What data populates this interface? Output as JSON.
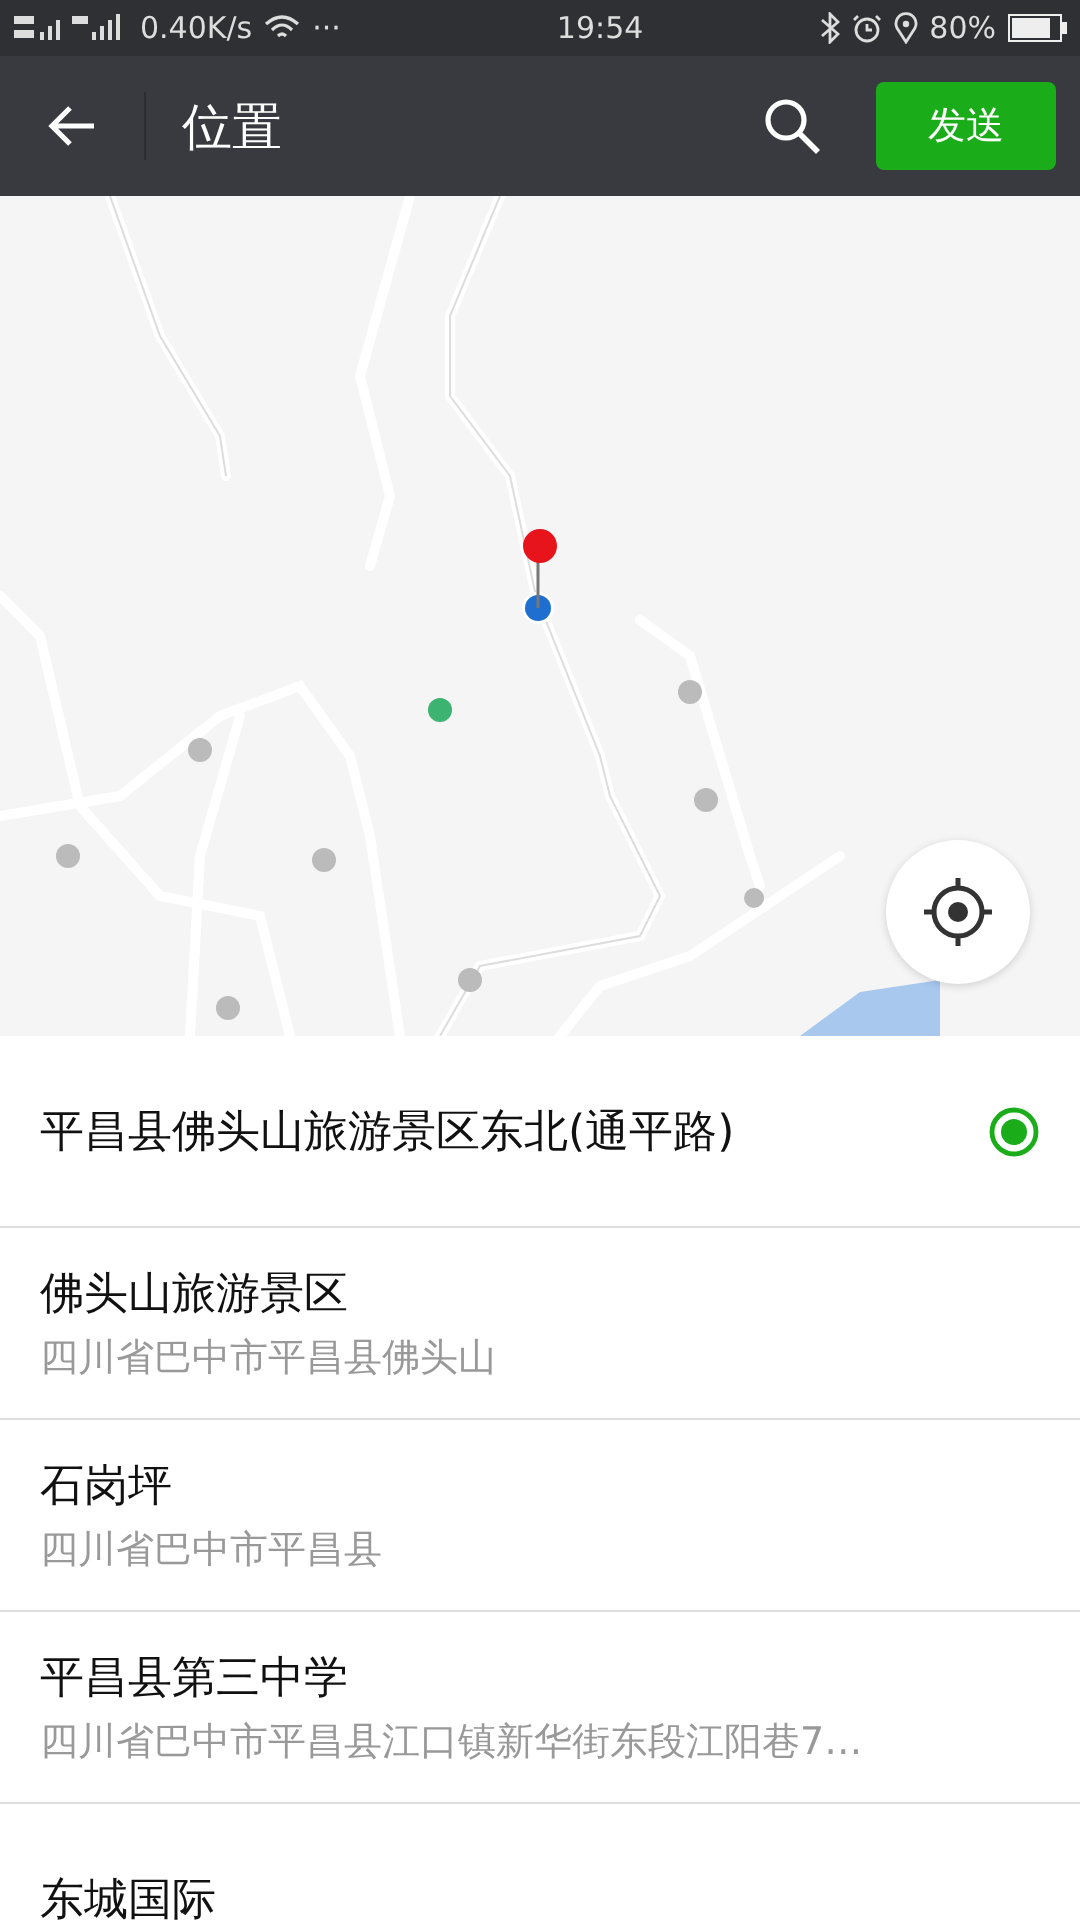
{
  "status_bar": {
    "network_speed": "0.40K/s",
    "more": "···",
    "time": "19:54",
    "battery": "80%"
  },
  "header": {
    "title": "位置",
    "send_button": "发送"
  },
  "places": [
    {
      "name": "平昌县佛头山旅游景区东北(通平路)",
      "selected": true
    },
    {
      "name": "佛头山旅游景区",
      "address": "四川省巴中市平昌县佛头山",
      "selected": false
    },
    {
      "name": "石岗坪",
      "address": "四川省巴中市平昌县",
      "selected": false
    },
    {
      "name": "平昌县第三中学",
      "address": "四川省巴中市平昌县江口镇新华街东段江阳巷7…",
      "selected": false
    },
    {
      "name": "东城国际",
      "selected": false
    }
  ]
}
